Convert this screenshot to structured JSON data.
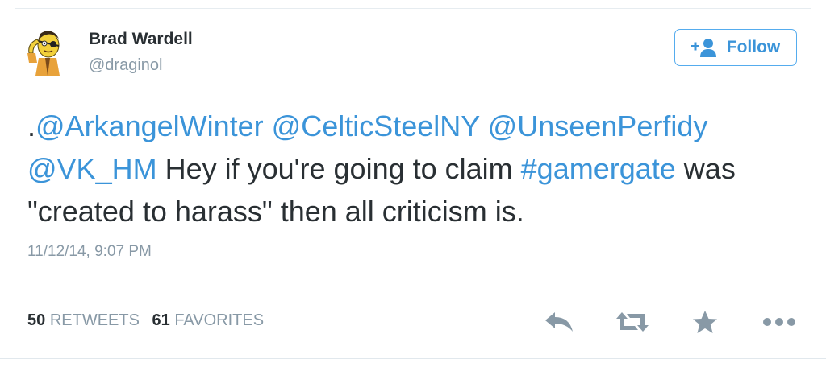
{
  "author": {
    "name": "Brad Wardell",
    "handle": "@draginol"
  },
  "follow_button": {
    "label": "Follow",
    "icon": "add-user-icon"
  },
  "tweet": {
    "lead": ".",
    "mention_1": "@ArkangelWinter",
    "mention_2": "@CelticSteelNY",
    "mention_3": "@UnseenPerfidy",
    "mention_4": "@VK_HM",
    "text_1": " Hey if you're going to claim ",
    "hashtag": "#gamergate",
    "text_2": " was \"created to harass\" then all criticism is.",
    "timestamp": "11/12/14, 9:07 PM"
  },
  "stats": {
    "retweets_count": "50",
    "retweets_label": "RETWEETS",
    "favorites_count": "61",
    "favorites_label": "FAVORITES"
  },
  "actions": {
    "reply": "reply-icon",
    "retweet": "retweet-icon",
    "favorite": "star-icon",
    "more": "more-dots-icon"
  },
  "colors": {
    "link": "#3b94d9",
    "text": "#292f33",
    "muted": "#8899a6",
    "divider": "#e1e8ed",
    "action_icon": "#8899a6"
  }
}
